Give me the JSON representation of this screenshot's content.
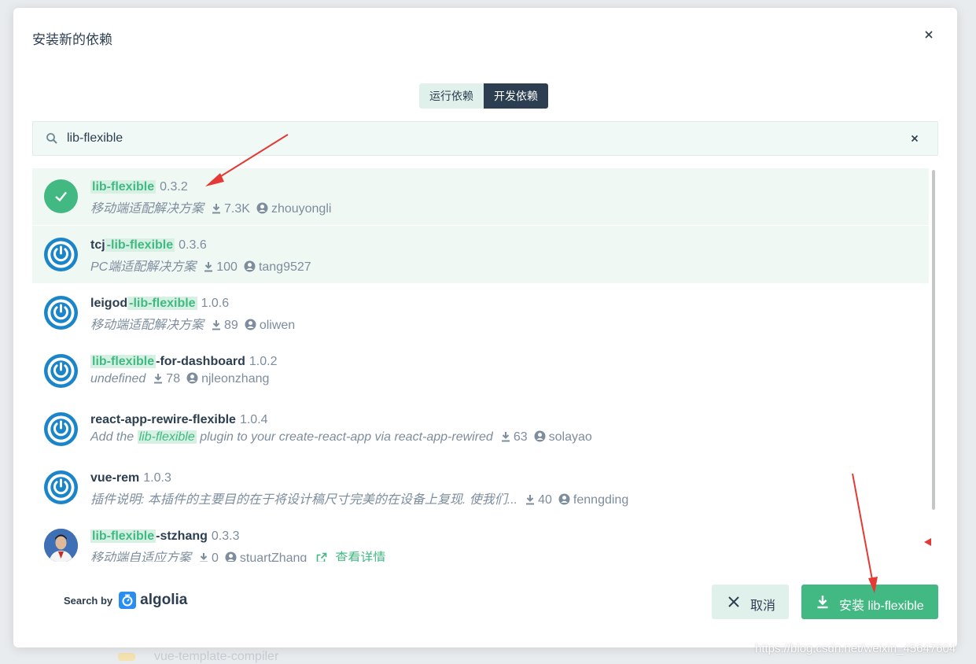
{
  "background": {
    "partial_text": "vue-template-compiler"
  },
  "dialog": {
    "title": "安装新的依赖",
    "tabs": [
      {
        "label": "运行依赖",
        "active": false
      },
      {
        "label": "开发依赖",
        "active": true
      }
    ],
    "search": {
      "value": "lib-flexible",
      "placeholder": ""
    },
    "results": [
      {
        "pre": "",
        "hl": "lib-flexible",
        "post": "",
        "version": "0.3.2",
        "desc": "移动端适配解决方案",
        "downloads": "7.3K",
        "author": "zhouyongli",
        "avatar": "check-icon",
        "selected": true
      },
      {
        "pre": "tcj",
        "hl": "-lib-flexible",
        "post": "",
        "version": "0.3.6",
        "desc": "PC端适配解决方案",
        "downloads": "100",
        "author": "tang9527",
        "avatar": "power-icon"
      },
      {
        "pre": "leigod",
        "hl": "-lib-flexible",
        "post": "",
        "version": "1.0.6",
        "desc": "移动端适配解决方案",
        "downloads": "89",
        "author": "oliwen",
        "avatar": "power-icon"
      },
      {
        "pre": "",
        "hl": "lib-flexible",
        "post": "-for-dashboard",
        "version": "1.0.2",
        "desc": "undefined",
        "downloads": "78",
        "author": "njleonzhang",
        "avatar": "power-icon"
      },
      {
        "pre": "react-app-rewire-flexible",
        "hl": "",
        "post": "",
        "version": "1.0.4",
        "desc_pre": "Add the",
        "desc_hl": "lib-flexible",
        "desc_post": " plugin to your create-react-app via react-app-rewired",
        "downloads": "63",
        "author": "solayao",
        "avatar": "power-icon"
      },
      {
        "pre": "vue-rem",
        "hl": "",
        "post": "",
        "version": "1.0.3",
        "desc": "插件说明: 本插件的主要目的在于将设计稿尺寸完美的在设备上复现. 使我们...",
        "downloads": "40",
        "author": "fenngding",
        "avatar": "power-icon"
      },
      {
        "pre": "",
        "hl": "lib-flexible",
        "post": "-stzhang",
        "version": "0.3.3",
        "desc": "移动端自适应方案",
        "downloads": "0",
        "author": "stuartZhang",
        "avatar": "user-photo",
        "details": "查看详情"
      }
    ],
    "footer": {
      "search_by": "Search by",
      "brand": "algolia",
      "cancel_label": "取消",
      "install_label": "安装 lib-flexible"
    }
  },
  "watermark": "https://blog.csdn.net/weixin_45647604",
  "colors": {
    "accent": "#42b983",
    "dark": "#2c3e50",
    "muted": "#7d8d9d",
    "annotation": "#e53935"
  }
}
